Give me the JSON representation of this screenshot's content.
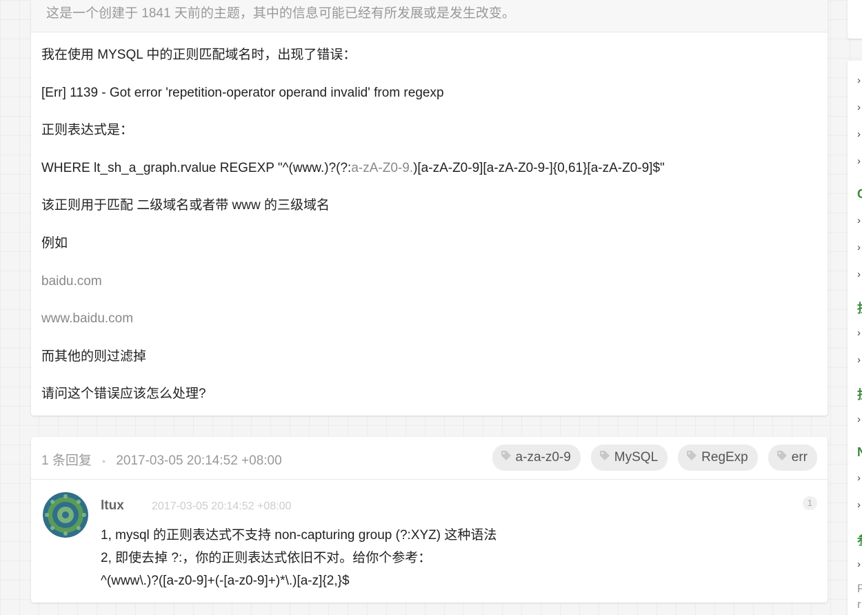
{
  "topic": {
    "outdated_notice": "这是一个创建于 1841 天前的主题，其中的信息可能已经有所发展或是发生改变。",
    "lines": [
      {
        "text": "我在使用 MYSQL 中的正则匹配域名时，出现了错误："
      },
      {
        "text": "[Err] 1139 - Got error 'repetition-operator operand invalid' from regexp"
      },
      {
        "text": "正则表达式是："
      },
      {
        "pre": "WHERE lt_sh_a_graph.rvalue REGEXP \"^(www.)?(?:",
        "muted": "a-zA-Z0-9.",
        "post": ")[a-zA-Z0-9][a-zA-Z0-9-]{0,61}[a-zA-Z0-9]$\""
      },
      {
        "text": "该正则用于匹配 二级域名或者带 www 的三级域名"
      },
      {
        "text": "例如"
      },
      {
        "link": "baidu.com"
      },
      {
        "link": "www.baidu.com"
      },
      {
        "text": "而其他的则过滤掉"
      },
      {
        "text": "请问这个错误应该怎么处理?"
      }
    ]
  },
  "reply_section": {
    "count": "1 条回复",
    "separator": "•",
    "timestamp": "2017-03-05 20:14:52 +08:00",
    "tags": [
      "a-za-z0-9",
      "MySQL",
      "RegExp",
      "err"
    ]
  },
  "replies": [
    {
      "username": "ltux",
      "time": "2017-03-05 20:14:52 +08:00",
      "number": "1",
      "lines": [
        "1, mysql 的正则表达式不支持 non-capturing group (?:XYZ) 这种语法",
        "2, 即使去掉 ?:，你的正则表达式依旧不对。给你个参考：",
        "^(www\\.)?([a-z0-9]+(-[a-z0-9]+)*\\.)[a-z]{2,}$"
      ]
    }
  ],
  "sidebar": {
    "marks": [
      {
        "text": "›"
      },
      {
        "text": "›"
      },
      {
        "text": "›"
      },
      {
        "text": "›"
      },
      {
        "text": "C"
      },
      {
        "text": "›"
      },
      {
        "text": "›"
      },
      {
        "text": "›"
      },
      {
        "text": "担"
      },
      {
        "text": "›"
      },
      {
        "text": "›"
      },
      {
        "text": "担"
      },
      {
        "text": "›"
      },
      {
        "text": "N"
      },
      {
        "text": "›"
      },
      {
        "text": "›"
      },
      {
        "text": "参"
      },
      {
        "text": "›"
      },
      {
        "text": "P"
      },
      {
        "text": "r"
      }
    ]
  },
  "colors": {
    "accent_green": "#3a8a3a",
    "tag_bg": "#ececec",
    "muted_text": "#888888"
  }
}
